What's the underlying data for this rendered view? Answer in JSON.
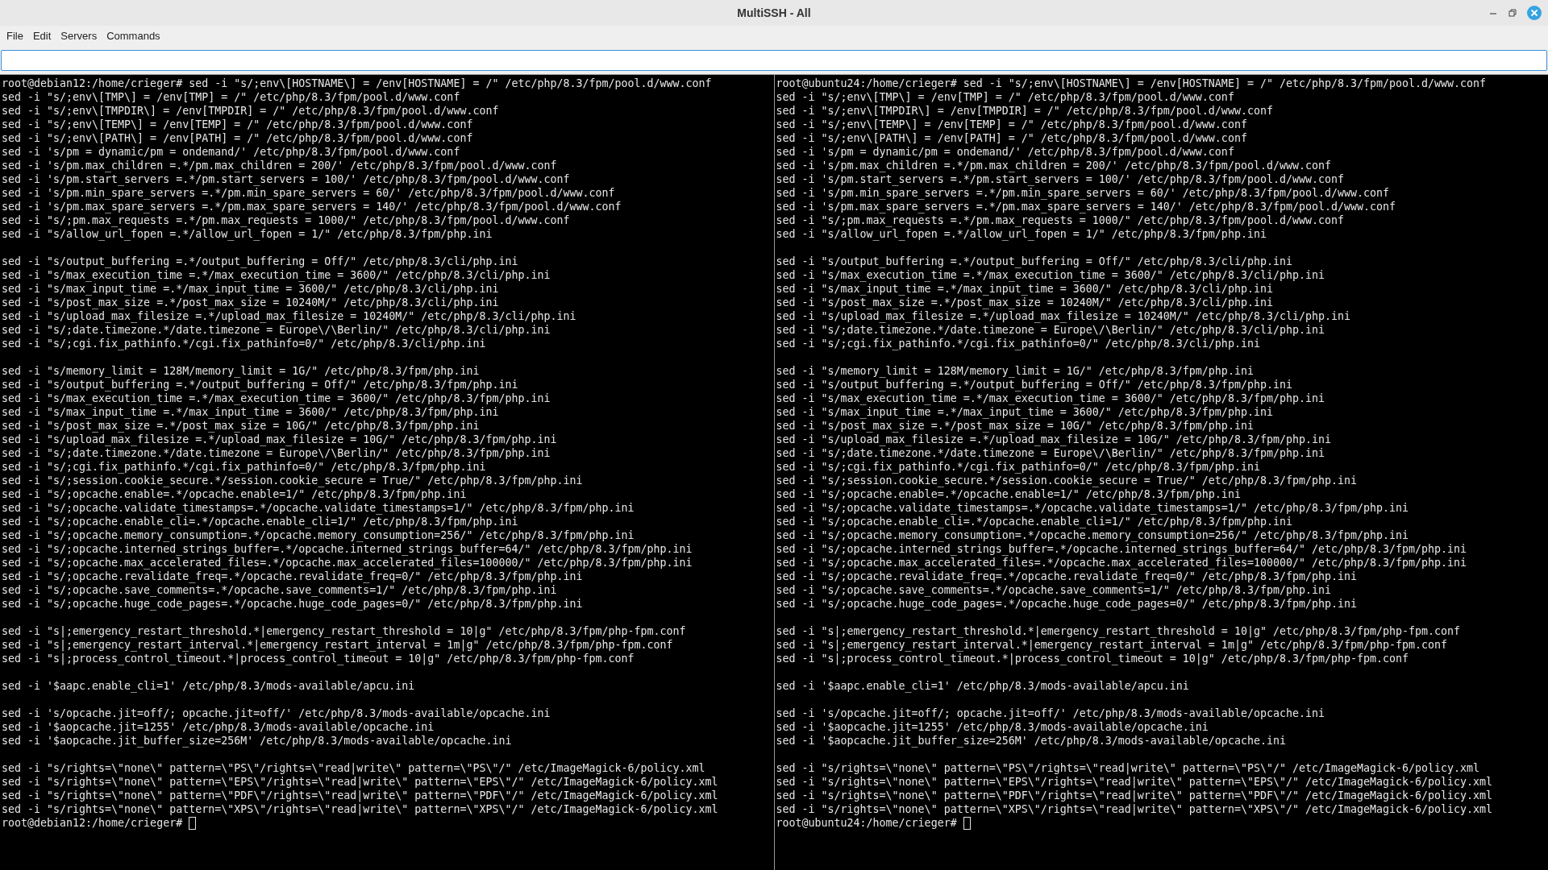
{
  "window": {
    "title": "MultiSSH - All"
  },
  "menu": [
    "File",
    "Edit",
    "Servers",
    "Commands"
  ],
  "panes": [
    {
      "prompt": "root@debian12:/home/crieger#",
      "blocks": [
        [
          "sed -i \"s/;env\\[HOSTNAME\\] = /env[HOSTNAME] = /\" /etc/php/8.3/fpm/pool.d/www.conf",
          "sed -i \"s/;env\\[TMP\\] = /env[TMP] = /\" /etc/php/8.3/fpm/pool.d/www.conf",
          "sed -i \"s/;env\\[TMPDIR\\] = /env[TMPDIR] = /\" /etc/php/8.3/fpm/pool.d/www.conf",
          "sed -i \"s/;env\\[TEMP\\] = /env[TEMP] = /\" /etc/php/8.3/fpm/pool.d/www.conf",
          "sed -i \"s/;env\\[PATH\\] = /env[PATH] = /\" /etc/php/8.3/fpm/pool.d/www.conf",
          "sed -i 's/pm = dynamic/pm = ondemand/' /etc/php/8.3/fpm/pool.d/www.conf",
          "sed -i 's/pm.max_children =.*/pm.max_children = 200/' /etc/php/8.3/fpm/pool.d/www.conf",
          "sed -i 's/pm.start_servers =.*/pm.start_servers = 100/' /etc/php/8.3/fpm/pool.d/www.conf",
          "sed -i 's/pm.min_spare_servers =.*/pm.min_spare_servers = 60/' /etc/php/8.3/fpm/pool.d/www.conf",
          "sed -i 's/pm.max_spare_servers =.*/pm.max_spare_servers = 140/' /etc/php/8.3/fpm/pool.d/www.conf",
          "sed -i \"s/;pm.max_requests =.*/pm.max_requests = 1000/\" /etc/php/8.3/fpm/pool.d/www.conf",
          "sed -i \"s/allow_url_fopen =.*/allow_url_fopen = 1/\" /etc/php/8.3/fpm/php.ini"
        ],
        [
          "sed -i \"s/output_buffering =.*/output_buffering = Off/\" /etc/php/8.3/cli/php.ini",
          "sed -i \"s/max_execution_time =.*/max_execution_time = 3600/\" /etc/php/8.3/cli/php.ini",
          "sed -i \"s/max_input_time =.*/max_input_time = 3600/\" /etc/php/8.3/cli/php.ini",
          "sed -i \"s/post_max_size =.*/post_max_size = 10240M/\" /etc/php/8.3/cli/php.ini",
          "sed -i \"s/upload_max_filesize =.*/upload_max_filesize = 10240M/\" /etc/php/8.3/cli/php.ini",
          "sed -i \"s/;date.timezone.*/date.timezone = Europe\\/\\Berlin/\" /etc/php/8.3/cli/php.ini",
          "sed -i \"s/;cgi.fix_pathinfo.*/cgi.fix_pathinfo=0/\" /etc/php/8.3/cli/php.ini"
        ],
        [
          "sed -i \"s/memory_limit = 128M/memory_limit = 1G/\" /etc/php/8.3/fpm/php.ini",
          "sed -i \"s/output_buffering =.*/output_buffering = Off/\" /etc/php/8.3/fpm/php.ini",
          "sed -i \"s/max_execution_time =.*/max_execution_time = 3600/\" /etc/php/8.3/fpm/php.ini",
          "sed -i \"s/max_input_time =.*/max_input_time = 3600/\" /etc/php/8.3/fpm/php.ini",
          "sed -i \"s/post_max_size =.*/post_max_size = 10G/\" /etc/php/8.3/fpm/php.ini",
          "sed -i \"s/upload_max_filesize =.*/upload_max_filesize = 10G/\" /etc/php/8.3/fpm/php.ini",
          "sed -i \"s/;date.timezone.*/date.timezone = Europe\\/\\Berlin/\" /etc/php/8.3/fpm/php.ini",
          "sed -i \"s/;cgi.fix_pathinfo.*/cgi.fix_pathinfo=0/\" /etc/php/8.3/fpm/php.ini",
          "sed -i \"s/;session.cookie_secure.*/session.cookie_secure = True/\" /etc/php/8.3/fpm/php.ini",
          "sed -i \"s/;opcache.enable=.*/opcache.enable=1/\" /etc/php/8.3/fpm/php.ini",
          "sed -i \"s/;opcache.validate_timestamps=.*/opcache.validate_timestamps=1/\" /etc/php/8.3/fpm/php.ini",
          "sed -i \"s/;opcache.enable_cli=.*/opcache.enable_cli=1/\" /etc/php/8.3/fpm/php.ini",
          "sed -i \"s/;opcache.memory_consumption=.*/opcache.memory_consumption=256/\" /etc/php/8.3/fpm/php.ini",
          "sed -i \"s/;opcache.interned_strings_buffer=.*/opcache.interned_strings_buffer=64/\" /etc/php/8.3/fpm/php.ini",
          "sed -i \"s/;opcache.max_accelerated_files=.*/opcache.max_accelerated_files=100000/\" /etc/php/8.3/fpm/php.ini",
          "sed -i \"s/;opcache.revalidate_freq=.*/opcache.revalidate_freq=0/\" /etc/php/8.3/fpm/php.ini",
          "sed -i \"s/;opcache.save_comments=.*/opcache.save_comments=1/\" /etc/php/8.3/fpm/php.ini",
          "sed -i \"s/;opcache.huge_code_pages=.*/opcache.huge_code_pages=0/\" /etc/php/8.3/fpm/php.ini"
        ],
        [
          "sed -i \"s|;emergency_restart_threshold.*|emergency_restart_threshold = 10|g\" /etc/php/8.3/fpm/php-fpm.conf",
          "sed -i \"s|;emergency_restart_interval.*|emergency_restart_interval = 1m|g\" /etc/php/8.3/fpm/php-fpm.conf",
          "sed -i \"s|;process_control_timeout.*|process_control_timeout = 10|g\" /etc/php/8.3/fpm/php-fpm.conf"
        ],
        [
          "sed -i '$aapc.enable_cli=1' /etc/php/8.3/mods-available/apcu.ini"
        ],
        [
          "sed -i 's/opcache.jit=off/; opcache.jit=off/' /etc/php/8.3/mods-available/opcache.ini",
          "sed -i '$aopcache.jit=1255' /etc/php/8.3/mods-available/opcache.ini",
          "sed -i '$aopcache.jit_buffer_size=256M' /etc/php/8.3/mods-available/opcache.ini"
        ],
        [
          "sed -i \"s/rights=\\\"none\\\" pattern=\\\"PS\\\"/rights=\\\"read|write\\\" pattern=\\\"PS\\\"/\" /etc/ImageMagick-6/policy.xml",
          "sed -i \"s/rights=\\\"none\\\" pattern=\\\"EPS\\\"/rights=\\\"read|write\\\" pattern=\\\"EPS\\\"/\" /etc/ImageMagick-6/policy.xml",
          "sed -i \"s/rights=\\\"none\\\" pattern=\\\"PDF\\\"/rights=\\\"read|write\\\" pattern=\\\"PDF\\\"/\" /etc/ImageMagick-6/policy.xml",
          "sed -i \"s/rights=\\\"none\\\" pattern=\\\"XPS\\\"/rights=\\\"read|write\\\" pattern=\\\"XPS\\\"/\" /etc/ImageMagick-6/policy.xml"
        ]
      ],
      "final_prompt": "root@debian12:/home/crieger#"
    },
    {
      "prompt": "root@ubuntu24:/home/crieger#",
      "blocks": [
        [
          "sed -i \"s/;env\\[HOSTNAME\\] = /env[HOSTNAME] = /\" /etc/php/8.3/fpm/pool.d/www.conf",
          "sed -i \"s/;env\\[TMP\\] = /env[TMP] = /\" /etc/php/8.3/fpm/pool.d/www.conf",
          "sed -i \"s/;env\\[TMPDIR\\] = /env[TMPDIR] = /\" /etc/php/8.3/fpm/pool.d/www.conf",
          "sed -i \"s/;env\\[TEMP\\] = /env[TEMP] = /\" /etc/php/8.3/fpm/pool.d/www.conf",
          "sed -i \"s/;env\\[PATH\\] = /env[PATH] = /\" /etc/php/8.3/fpm/pool.d/www.conf",
          "sed -i 's/pm = dynamic/pm = ondemand/' /etc/php/8.3/fpm/pool.d/www.conf",
          "sed -i 's/pm.max_children =.*/pm.max_children = 200/' /etc/php/8.3/fpm/pool.d/www.conf",
          "sed -i 's/pm.start_servers =.*/pm.start_servers = 100/' /etc/php/8.3/fpm/pool.d/www.conf",
          "sed -i 's/pm.min_spare_servers =.*/pm.min_spare_servers = 60/' /etc/php/8.3/fpm/pool.d/www.conf",
          "sed -i 's/pm.max_spare_servers =.*/pm.max_spare_servers = 140/' /etc/php/8.3/fpm/pool.d/www.conf",
          "sed -i \"s/;pm.max_requests =.*/pm.max_requests = 1000/\" /etc/php/8.3/fpm/pool.d/www.conf",
          "sed -i \"s/allow_url_fopen =.*/allow_url_fopen = 1/\" /etc/php/8.3/fpm/php.ini"
        ],
        [
          "sed -i \"s/output_buffering =.*/output_buffering = Off/\" /etc/php/8.3/cli/php.ini",
          "sed -i \"s/max_execution_time =.*/max_execution_time = 3600/\" /etc/php/8.3/cli/php.ini",
          "sed -i \"s/max_input_time =.*/max_input_time = 3600/\" /etc/php/8.3/cli/php.ini",
          "sed -i \"s/post_max_size =.*/post_max_size = 10240M/\" /etc/php/8.3/cli/php.ini",
          "sed -i \"s/upload_max_filesize =.*/upload_max_filesize = 10240M/\" /etc/php/8.3/cli/php.ini",
          "sed -i \"s/;date.timezone.*/date.timezone = Europe\\/\\Berlin/\" /etc/php/8.3/cli/php.ini",
          "sed -i \"s/;cgi.fix_pathinfo.*/cgi.fix_pathinfo=0/\" /etc/php/8.3/cli/php.ini"
        ],
        [
          "sed -i \"s/memory_limit = 128M/memory_limit = 1G/\" /etc/php/8.3/fpm/php.ini",
          "sed -i \"s/output_buffering =.*/output_buffering = Off/\" /etc/php/8.3/fpm/php.ini",
          "sed -i \"s/max_execution_time =.*/max_execution_time = 3600/\" /etc/php/8.3/fpm/php.ini",
          "sed -i \"s/max_input_time =.*/max_input_time = 3600/\" /etc/php/8.3/fpm/php.ini",
          "sed -i \"s/post_max_size =.*/post_max_size = 10G/\" /etc/php/8.3/fpm/php.ini",
          "sed -i \"s/upload_max_filesize =.*/upload_max_filesize = 10G/\" /etc/php/8.3/fpm/php.ini",
          "sed -i \"s/;date.timezone.*/date.timezone = Europe\\/\\Berlin/\" /etc/php/8.3/fpm/php.ini",
          "sed -i \"s/;cgi.fix_pathinfo.*/cgi.fix_pathinfo=0/\" /etc/php/8.3/fpm/php.ini",
          "sed -i \"s/;session.cookie_secure.*/session.cookie_secure = True/\" /etc/php/8.3/fpm/php.ini",
          "sed -i \"s/;opcache.enable=.*/opcache.enable=1/\" /etc/php/8.3/fpm/php.ini",
          "sed -i \"s/;opcache.validate_timestamps=.*/opcache.validate_timestamps=1/\" /etc/php/8.3/fpm/php.ini",
          "sed -i \"s/;opcache.enable_cli=.*/opcache.enable_cli=1/\" /etc/php/8.3/fpm/php.ini",
          "sed -i \"s/;opcache.memory_consumption=.*/opcache.memory_consumption=256/\" /etc/php/8.3/fpm/php.ini",
          "sed -i \"s/;opcache.interned_strings_buffer=.*/opcache.interned_strings_buffer=64/\" /etc/php/8.3/fpm/php.ini",
          "sed -i \"s/;opcache.max_accelerated_files=.*/opcache.max_accelerated_files=100000/\" /etc/php/8.3/fpm/php.ini",
          "sed -i \"s/;opcache.revalidate_freq=.*/opcache.revalidate_freq=0/\" /etc/php/8.3/fpm/php.ini",
          "sed -i \"s/;opcache.save_comments=.*/opcache.save_comments=1/\" /etc/php/8.3/fpm/php.ini",
          "sed -i \"s/;opcache.huge_code_pages=.*/opcache.huge_code_pages=0/\" /etc/php/8.3/fpm/php.ini"
        ],
        [
          "sed -i \"s|;emergency_restart_threshold.*|emergency_restart_threshold = 10|g\" /etc/php/8.3/fpm/php-fpm.conf",
          "sed -i \"s|;emergency_restart_interval.*|emergency_restart_interval = 1m|g\" /etc/php/8.3/fpm/php-fpm.conf",
          "sed -i \"s|;process_control_timeout.*|process_control_timeout = 10|g\" /etc/php/8.3/fpm/php-fpm.conf"
        ],
        [
          "sed -i '$aapc.enable_cli=1' /etc/php/8.3/mods-available/apcu.ini"
        ],
        [
          "sed -i 's/opcache.jit=off/; opcache.jit=off/' /etc/php/8.3/mods-available/opcache.ini",
          "sed -i '$aopcache.jit=1255' /etc/php/8.3/mods-available/opcache.ini",
          "sed -i '$aopcache.jit_buffer_size=256M' /etc/php/8.3/mods-available/opcache.ini"
        ],
        [
          "sed -i \"s/rights=\\\"none\\\" pattern=\\\"PS\\\"/rights=\\\"read|write\\\" pattern=\\\"PS\\\"/\" /etc/ImageMagick-6/policy.xml",
          "sed -i \"s/rights=\\\"none\\\" pattern=\\\"EPS\\\"/rights=\\\"read|write\\\" pattern=\\\"EPS\\\"/\" /etc/ImageMagick-6/policy.xml",
          "sed -i \"s/rights=\\\"none\\\" pattern=\\\"PDF\\\"/rights=\\\"read|write\\\" pattern=\\\"PDF\\\"/\" /etc/ImageMagick-6/policy.xml",
          "sed -i \"s/rights=\\\"none\\\" pattern=\\\"XPS\\\"/rights=\\\"read|write\\\" pattern=\\\"XPS\\\"/\" /etc/ImageMagick-6/policy.xml"
        ]
      ],
      "final_prompt": "root@ubuntu24:/home/crieger#"
    }
  ]
}
